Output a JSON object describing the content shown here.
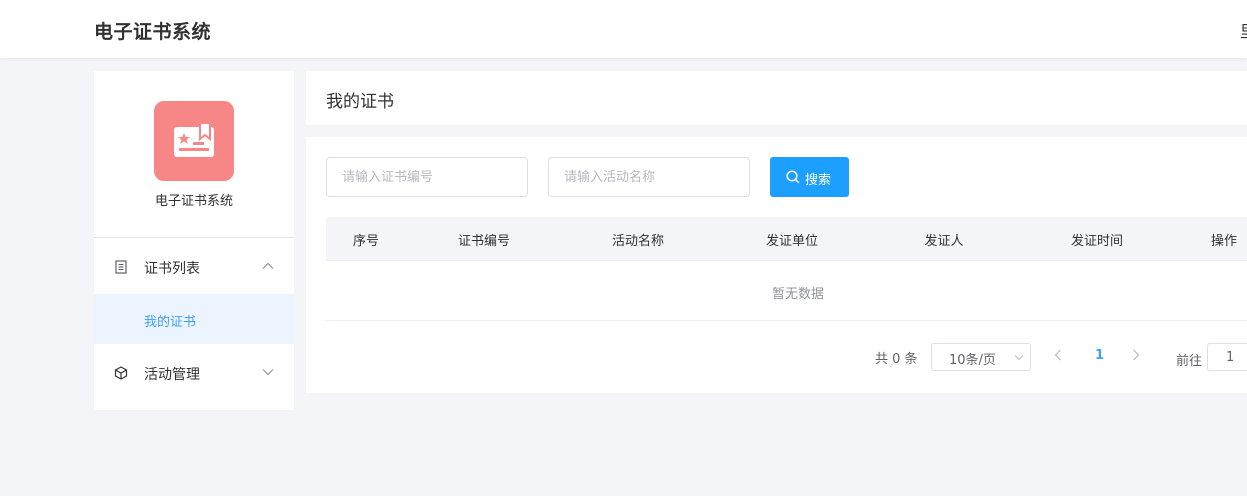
{
  "header": {
    "app_title": "电子证书系统",
    "right_text": "里"
  },
  "sidebar": {
    "logo_icon": "certificate-icon",
    "logo_color": "#f78687",
    "system_name": "电子证书系统",
    "menu": [
      {
        "label": "证书列表",
        "icon": "document-icon",
        "expanded": true,
        "children": [
          {
            "label": "我的证书",
            "active": true
          }
        ]
      },
      {
        "label": "活动管理",
        "icon": "cube-icon",
        "expanded": false
      }
    ]
  },
  "page": {
    "title": "我的证书"
  },
  "search": {
    "cert_no_placeholder": "请输入证书编号",
    "activity_placeholder": "请输入活动名称",
    "button_label": "搜索",
    "button_color": "#1c9fff"
  },
  "table": {
    "columns": [
      "序号",
      "证书编号",
      "活动名称",
      "发证单位",
      "发证人",
      "发证时间",
      "操作"
    ],
    "rows": [],
    "empty_text": "暂无数据"
  },
  "pagination": {
    "total_text": "共 0 条",
    "page_size": "10条/页",
    "current_page": "1",
    "goto_label": "前往",
    "goto_value": "1"
  },
  "accent_color": "#409eff"
}
